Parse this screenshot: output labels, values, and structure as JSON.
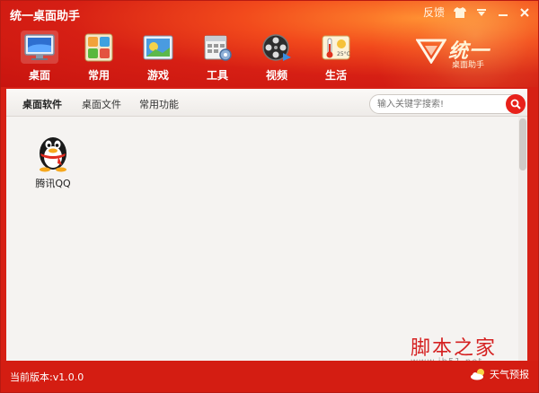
{
  "window": {
    "title": "统一桌面助手"
  },
  "titlebar": {
    "feedback_label": "反馈"
  },
  "brand": {
    "name": "统一",
    "subtitle": "桌面助手"
  },
  "nav": {
    "items": [
      {
        "label": "桌面",
        "icon": "desktop-icon",
        "active": true
      },
      {
        "label": "常用",
        "icon": "common-apps-icon"
      },
      {
        "label": "游戏",
        "icon": "game-icon"
      },
      {
        "label": "工具",
        "icon": "tools-icon"
      },
      {
        "label": "视频",
        "icon": "video-icon"
      },
      {
        "label": "生活",
        "icon": "life-icon"
      }
    ]
  },
  "tabs": [
    {
      "label": "桌面软件",
      "active": true
    },
    {
      "label": "桌面文件"
    },
    {
      "label": "常用功能"
    }
  ],
  "search": {
    "placeholder": "输入关键字搜索!"
  },
  "apps": [
    {
      "name": "腾讯QQ",
      "icon": "qq-penguin-icon"
    }
  ],
  "watermark": {
    "text": "脚本之家",
    "url": "www.jb51.net"
  },
  "status": {
    "version": "当前版本:v1.0.0",
    "weather_label": "天气预报"
  },
  "colors": {
    "accent": "#d62015",
    "search_button": "#e8211a"
  }
}
